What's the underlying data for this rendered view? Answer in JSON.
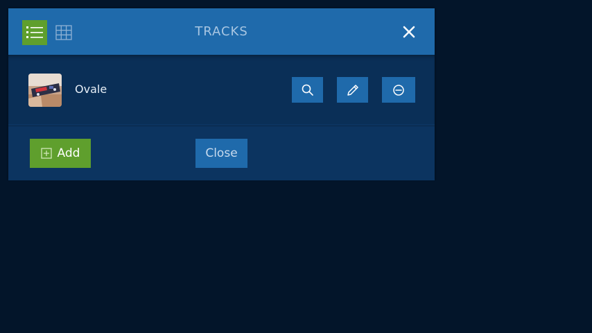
{
  "dialog": {
    "title": "TRACKS",
    "view_modes": [
      {
        "name": "list",
        "icon": "list-icon",
        "active": true
      },
      {
        "name": "grid",
        "icon": "grid-icon",
        "active": false
      }
    ],
    "close_icon": "close-icon"
  },
  "tracks": [
    {
      "name": "Ovale",
      "thumbnail": "track-thumbnail",
      "actions": [
        "search-icon",
        "pencil-icon",
        "minus-circle-icon"
      ]
    }
  ],
  "footer": {
    "add_label": "Add",
    "close_label": "Close"
  },
  "colors": {
    "background": "#03152a",
    "header": "#1f6aab",
    "panel": "#0c3460",
    "accent_green": "#5f9f2d",
    "button_blue": "#1f6aab"
  }
}
